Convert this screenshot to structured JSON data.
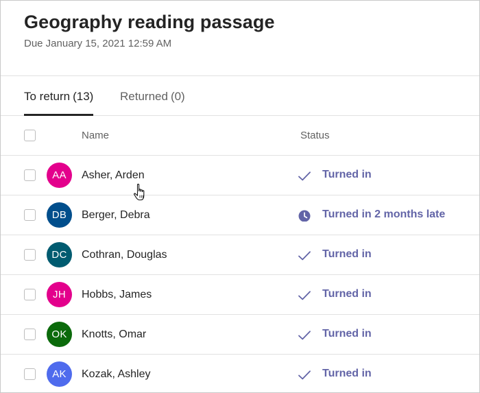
{
  "assignment": {
    "title": "Geography reading passage",
    "due": "Due January 15, 2021 12:59 AM"
  },
  "tabs": [
    {
      "label": "To return",
      "count": "(13)",
      "active": true
    },
    {
      "label": "Returned",
      "count": "(0)",
      "active": false
    }
  ],
  "columns": {
    "name": "Name",
    "status": "Status"
  },
  "colors": {
    "status_accent": "#6264a7",
    "text_primary": "#242424",
    "text_secondary": "#616161",
    "divider": "#e1e1e1"
  },
  "students": [
    {
      "initials": "AA",
      "name": "Asher, Arden",
      "avatar_color": "#e3008c",
      "status": "Turned in",
      "status_icon": "check-icon"
    },
    {
      "initials": "DB",
      "name": "Berger, Debra",
      "avatar_color": "#004e8c",
      "status": "Turned in 2 months late",
      "status_icon": "clock-icon"
    },
    {
      "initials": "DC",
      "name": "Cothran, Douglas",
      "avatar_color": "#005b70",
      "status": "Turned in",
      "status_icon": "check-icon"
    },
    {
      "initials": "JH",
      "name": "Hobbs, James",
      "avatar_color": "#e3008c",
      "status": "Turned in",
      "status_icon": "check-icon"
    },
    {
      "initials": "OK",
      "name": "Knotts, Omar",
      "avatar_color": "#0b6a0b",
      "status": "Turned in",
      "status_icon": "check-icon"
    },
    {
      "initials": "AK",
      "name": "Kozak, Ashley",
      "avatar_color": "#4f6bed",
      "status": "Turned in",
      "status_icon": "check-icon"
    }
  ]
}
